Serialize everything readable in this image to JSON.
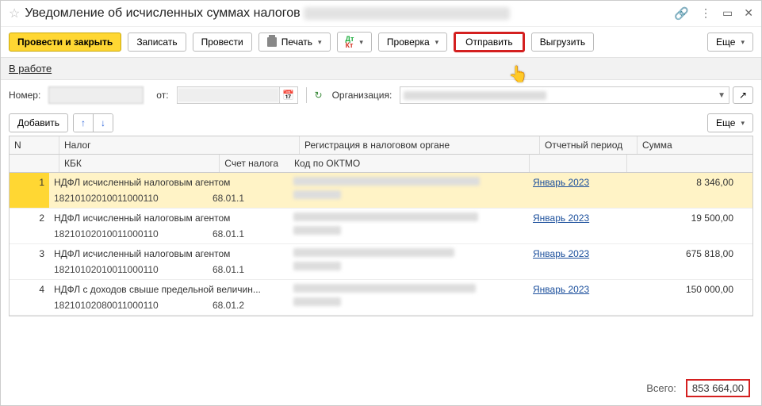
{
  "titlebar": {
    "title": "Уведомление об исчисленных суммах налогов"
  },
  "toolbar": {
    "post_close": "Провести и закрыть",
    "save": "Записать",
    "post": "Провести",
    "print": "Печать",
    "check": "Проверка",
    "send": "Отправить",
    "export": "Выгрузить",
    "more": "Еще"
  },
  "status": {
    "label": "В работе"
  },
  "form": {
    "number_label": "Номер:",
    "date_label": "от:",
    "org_label": "Организация:"
  },
  "table_toolbar": {
    "add": "Добавить",
    "more": "Еще"
  },
  "headers": {
    "n": "N",
    "tax": "Налог",
    "kbk": "КБК",
    "acct": "Счет налога",
    "reg": "Регистрация в налоговом органе",
    "oktmo": "Код по ОКТМО",
    "period": "Отчетный период",
    "sum": "Сумма"
  },
  "rows": [
    {
      "n": "1",
      "tax": "НДФЛ исчисленный налоговым агентом",
      "kbk": "18210102010011000110",
      "acct": "68.01.1",
      "period": "Январь 2023",
      "sum": "8 346,00"
    },
    {
      "n": "2",
      "tax": "НДФЛ исчисленный налоговым агентом",
      "kbk": "18210102010011000110",
      "acct": "68.01.1",
      "period": "Январь 2023",
      "sum": "19 500,00"
    },
    {
      "n": "3",
      "tax": "НДФЛ исчисленный налоговым агентом",
      "kbk": "18210102010011000110",
      "acct": "68.01.1",
      "period": "Январь 2023",
      "sum": "675 818,00"
    },
    {
      "n": "4",
      "tax": "НДФЛ с доходов свыше предельной величин...",
      "kbk": "18210102080011000110",
      "acct": "68.01.2",
      "period": "Январь 2023",
      "sum": "150 000,00"
    }
  ],
  "footer": {
    "total_label": "Всего:",
    "total_value": "853 664,00"
  }
}
